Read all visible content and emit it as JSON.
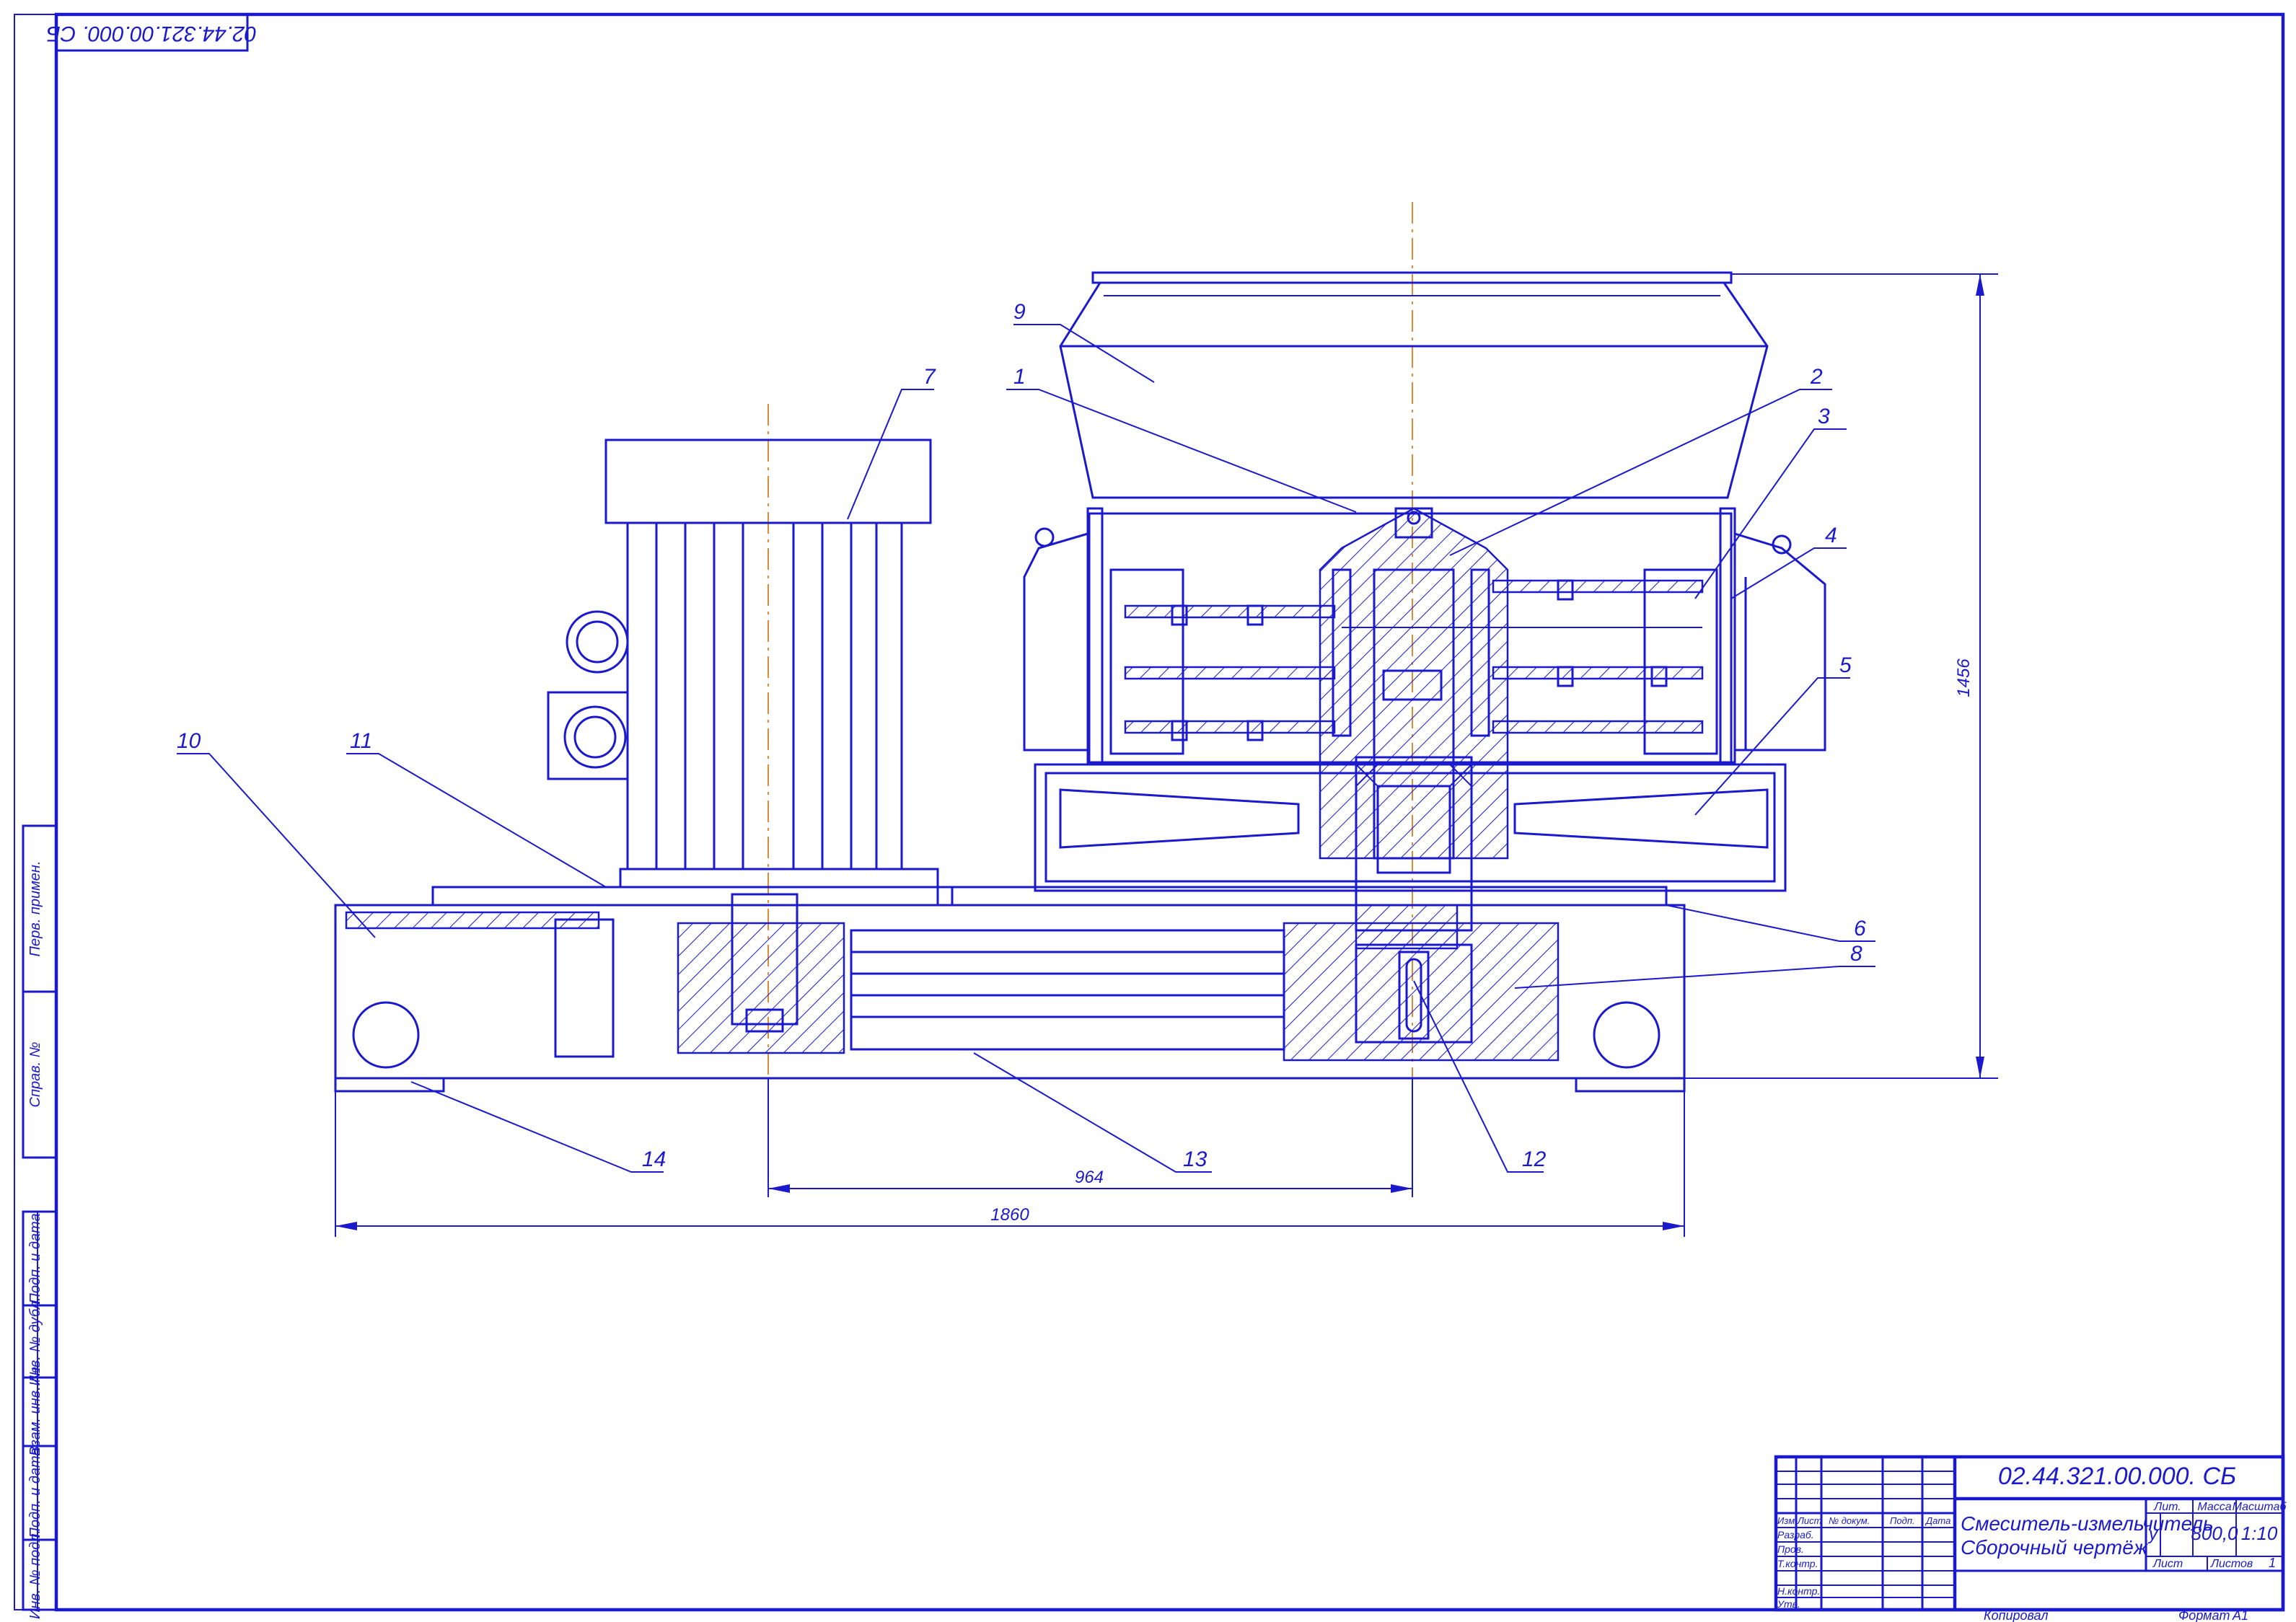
{
  "drawing": {
    "code_corner": "02.44.321.00.000. СБ",
    "code": "02.44.321.00.000. СБ",
    "title_line1": "Смеситель-измельчитель",
    "title_line2": "Сборочный чертёж",
    "litera": "у",
    "mass": "800,0",
    "scale": "1:10",
    "sheet_count": "1",
    "copied": "Копировал",
    "format": "Формат",
    "format_value": "А1"
  },
  "title_block_headers": {
    "lit": "Лит.",
    "mass": "Масса",
    "scale": "Масштаб",
    "sheet": "Лист",
    "sheets": "Листов",
    "izm": "Изм.",
    "list": "Лист",
    "doc": "№ докум.",
    "sign": "Подп.",
    "date": "Дата",
    "razrab": "Разраб.",
    "prov": "Пров.",
    "tkontr": "Т.контр.",
    "nkontr": "Н.контр.",
    "utv": "Утв."
  },
  "side_stamp": {
    "perv": "Перв. примен.",
    "sprav": "Справ. №",
    "podp_data1": "Подп. и дата",
    "inv_dubl": "Инв. № дубл.",
    "vzam": "Взам. инв. №",
    "podp_data2": "Подп. и дата",
    "inv_podl": "Инв. № подл."
  },
  "dimensions": {
    "height": "1456",
    "shaft_distance": "964",
    "length": "1860"
  },
  "callouts": [
    "1",
    "2",
    "3",
    "4",
    "5",
    "6",
    "7",
    "8",
    "9",
    "10",
    "11",
    "12",
    "13",
    "14"
  ]
}
